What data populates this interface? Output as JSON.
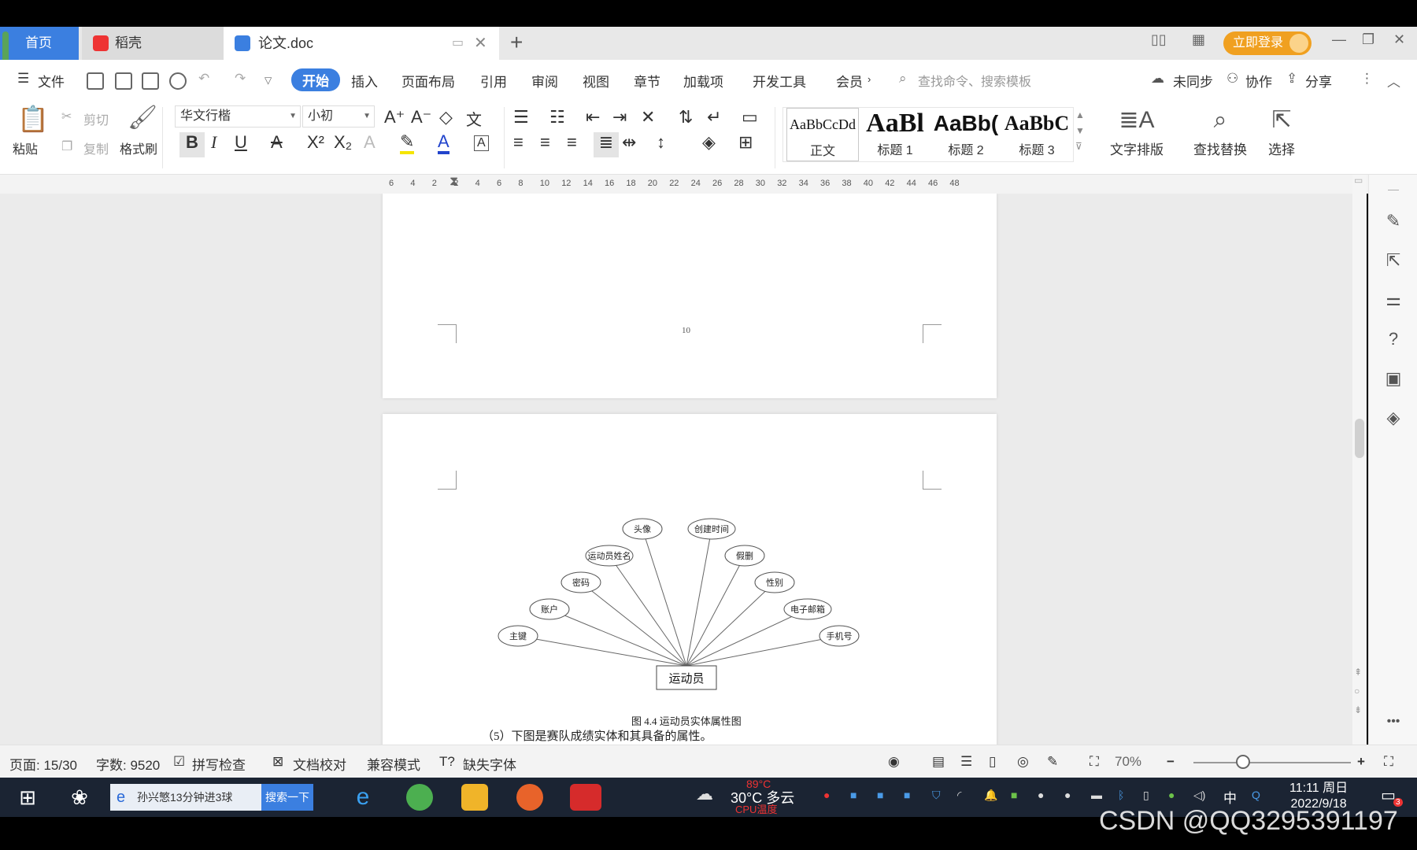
{
  "titlebar": {
    "home_tab": "首页",
    "daoke_tab": "稻壳",
    "doc_tab": "论文.doc",
    "login": "立即登录"
  },
  "menu": {
    "file": "文件",
    "items": [
      "开始",
      "插入",
      "页面布局",
      "引用",
      "审阅",
      "视图",
      "章节",
      "加载项",
      "开发工具",
      "会员"
    ],
    "search_placeholder": "查找命令、搜索模板",
    "sync": "未同步",
    "collab": "协作",
    "share": "分享"
  },
  "ribbon": {
    "paste": "粘贴",
    "cut": "剪切",
    "copy": "复制",
    "format_painter": "格式刷",
    "font_name": "华文行楷",
    "font_size": "小初",
    "styles": [
      {
        "preview": "AaBbCcDd",
        "name": "正文"
      },
      {
        "preview": "AaBl",
        "name": "标题 1"
      },
      {
        "preview": "AaBb(",
        "name": "标题 2"
      },
      {
        "preview": "AaBbC",
        "name": "标题 3"
      }
    ],
    "text_layout": "文字排版",
    "find_replace": "查找替换",
    "select": "选择"
  },
  "ruler": [
    "6",
    "4",
    "2",
    "2",
    "4",
    "6",
    "8",
    "10",
    "12",
    "14",
    "16",
    "18",
    "20",
    "22",
    "24",
    "26",
    "28",
    "30",
    "32",
    "34",
    "36",
    "38",
    "40",
    "42",
    "44",
    "46",
    "48"
  ],
  "document": {
    "page_number": "10",
    "diagram": {
      "entity": "运动员",
      "attributes": [
        "主键",
        "账户",
        "密码",
        "运动员姓名",
        "头像",
        "创建时间",
        "假删",
        "性别",
        "电子邮箱",
        "手机号"
      ]
    },
    "caption": "图 4.4 运动员实体属性图",
    "body_line": "（5）下图是赛队成绩实体和其具备的属性。"
  },
  "status": {
    "page": "页面: 15/30",
    "words": "字数: 9520",
    "spellcheck": "拼写检查",
    "proofread": "文档校对",
    "compat": "兼容模式",
    "missing_font": "缺失字体",
    "zoom": "70%"
  },
  "taskbar": {
    "search_text": "孙兴慜13分钟进3球",
    "search_button": "搜索一下",
    "weather": "30°C 多云",
    "cpu_temp": "89°C",
    "cpu_label": "CPU温度",
    "ime": "中",
    "time": "11:11 周日",
    "date": "2022/9/18",
    "notif_count": "3"
  },
  "watermark": "CSDN @QQ3295391197"
}
